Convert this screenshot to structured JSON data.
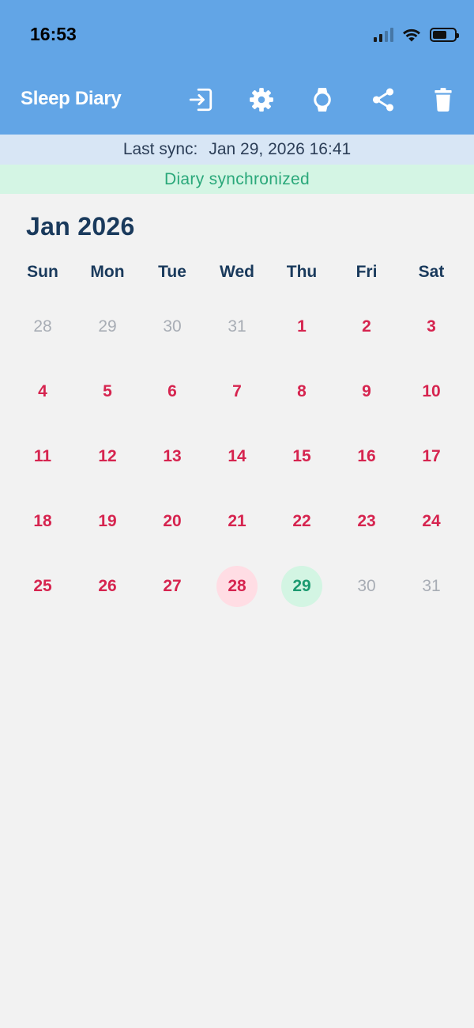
{
  "status": {
    "time": "16:53",
    "battery_level": 0.65
  },
  "header": {
    "title": "Sleep Diary"
  },
  "toolbar": {
    "icons": [
      "logout-icon",
      "gear-icon",
      "watch-icon",
      "share-icon",
      "trash-icon"
    ]
  },
  "sync": {
    "label": "Last sync:",
    "value": "Jan 29, 2026 16:41"
  },
  "sync_status": "Diary synchronized",
  "calendar": {
    "month": "Jan 2026",
    "weekdays": [
      "Sun",
      "Mon",
      "Tue",
      "Wed",
      "Thu",
      "Fri",
      "Sat"
    ],
    "days": [
      {
        "label": "28",
        "state": "other"
      },
      {
        "label": "29",
        "state": "other"
      },
      {
        "label": "30",
        "state": "other"
      },
      {
        "label": "31",
        "state": "other"
      },
      {
        "label": "1",
        "state": "current"
      },
      {
        "label": "2",
        "state": "current"
      },
      {
        "label": "3",
        "state": "current"
      },
      {
        "label": "4",
        "state": "current"
      },
      {
        "label": "5",
        "state": "current"
      },
      {
        "label": "6",
        "state": "current"
      },
      {
        "label": "7",
        "state": "current"
      },
      {
        "label": "8",
        "state": "current"
      },
      {
        "label": "9",
        "state": "current"
      },
      {
        "label": "10",
        "state": "current"
      },
      {
        "label": "11",
        "state": "current"
      },
      {
        "label": "12",
        "state": "current"
      },
      {
        "label": "13",
        "state": "current"
      },
      {
        "label": "14",
        "state": "current"
      },
      {
        "label": "15",
        "state": "current"
      },
      {
        "label": "16",
        "state": "current"
      },
      {
        "label": "17",
        "state": "current"
      },
      {
        "label": "18",
        "state": "current"
      },
      {
        "label": "19",
        "state": "current"
      },
      {
        "label": "20",
        "state": "current"
      },
      {
        "label": "21",
        "state": "current"
      },
      {
        "label": "22",
        "state": "current"
      },
      {
        "label": "23",
        "state": "current"
      },
      {
        "label": "24",
        "state": "current"
      },
      {
        "label": "25",
        "state": "current"
      },
      {
        "label": "26",
        "state": "current"
      },
      {
        "label": "27",
        "state": "current"
      },
      {
        "label": "28",
        "state": "yesterday"
      },
      {
        "label": "29",
        "state": "today"
      },
      {
        "label": "30",
        "state": "other"
      },
      {
        "label": "31",
        "state": "other"
      }
    ]
  },
  "colors": {
    "header_bg": "#62a5e6",
    "accent_red": "#d6244f",
    "accent_green": "#1b9a70",
    "sync_bg": "#d8e6f5",
    "status_bg": "#d4f5e4"
  }
}
